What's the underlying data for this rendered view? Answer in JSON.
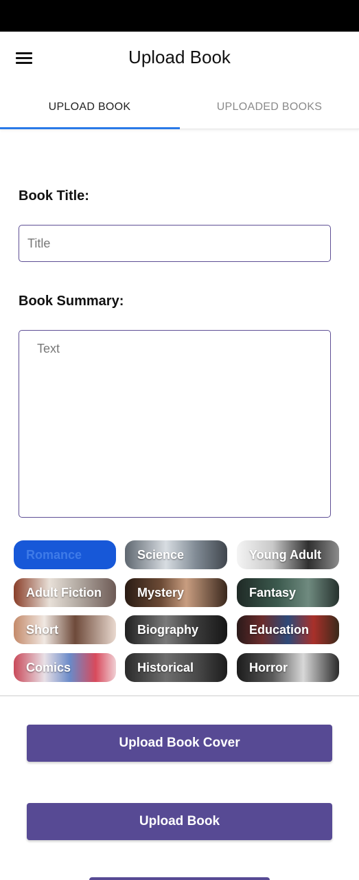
{
  "app_bar": {
    "title": "Upload Book",
    "menu_icon": "hamburger-menu-icon"
  },
  "tabs": [
    {
      "label": "UPLOAD BOOK",
      "active": true
    },
    {
      "label": "UPLOADED BOOKS",
      "active": false
    }
  ],
  "form": {
    "title_label": "Book Title:",
    "title_placeholder": "Title",
    "title_value": "",
    "summary_label": "Book Summary:",
    "summary_placeholder": "Text",
    "summary_value": ""
  },
  "genres": [
    {
      "label": "Romance",
      "selected": true
    },
    {
      "label": "Science",
      "selected": false
    },
    {
      "label": "Young Adult",
      "selected": false
    },
    {
      "label": "Adult Fiction",
      "selected": false
    },
    {
      "label": "Mystery",
      "selected": false
    },
    {
      "label": "Fantasy",
      "selected": false
    },
    {
      "label": "Short",
      "selected": false
    },
    {
      "label": "Biography",
      "selected": false
    },
    {
      "label": "Education",
      "selected": false
    },
    {
      "label": "Comics",
      "selected": false
    },
    {
      "label": "Historical",
      "selected": false
    },
    {
      "label": "Horror",
      "selected": false
    }
  ],
  "actions": {
    "upload_cover_label": "Upload Book Cover",
    "upload_book_label": "Upload Book"
  },
  "colors": {
    "accent": "#574a94",
    "tab_indicator": "#2979e8",
    "selected_chip": "#1758d8",
    "status_bar": "#000000"
  }
}
